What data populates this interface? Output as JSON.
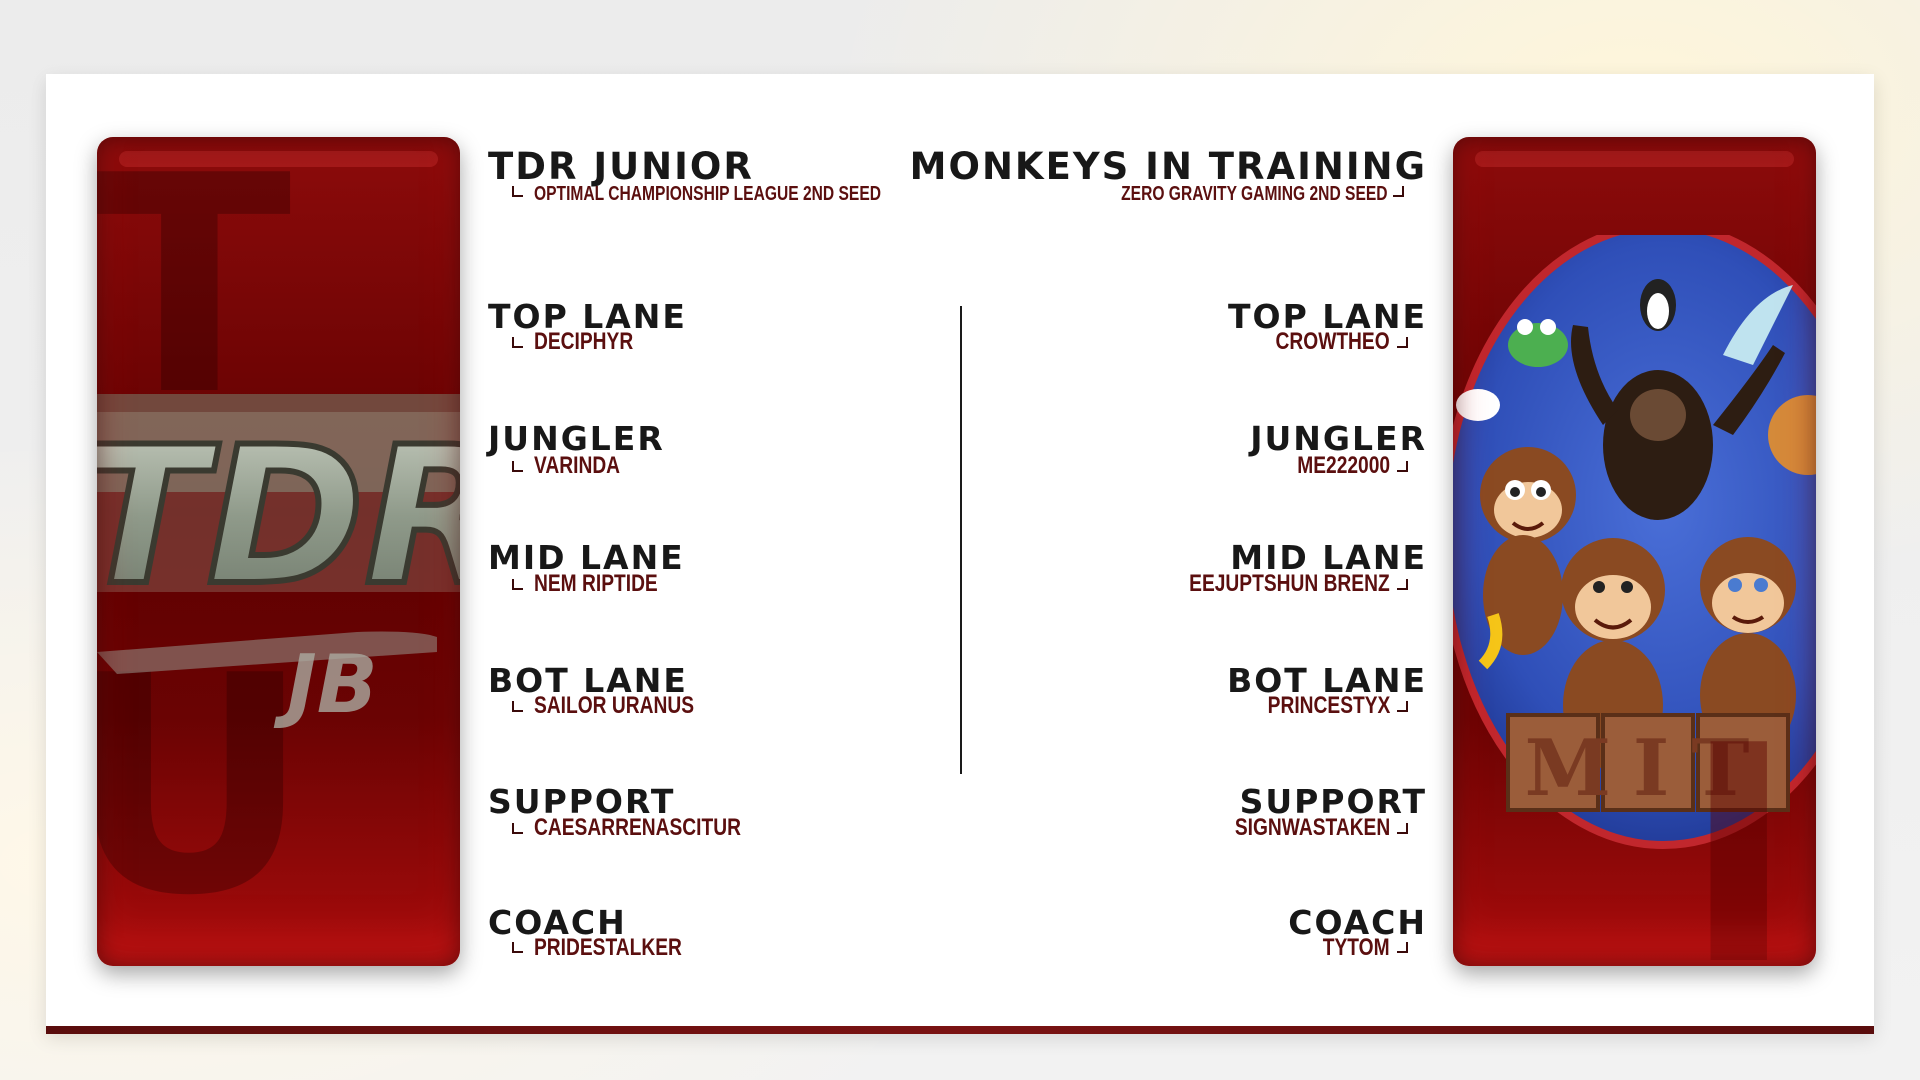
{
  "home": {
    "team_name": "TDR JUNIOR",
    "seed": "OPTIMAL CHAMPIONSHIP LEAGUE 2ND SEED",
    "logo_text": "TDR",
    "roster": [
      {
        "role": "TOP LANE",
        "player": "DECIPHYR"
      },
      {
        "role": "JUNGLER",
        "player": "VARINDA"
      },
      {
        "role": "MID LANE",
        "player": "NEM RIPTIDE"
      },
      {
        "role": "BOT LANE",
        "player": "SAILOR URANUS"
      },
      {
        "role": "SUPPORT",
        "player": "CAESARRENASCITUR"
      },
      {
        "role": "COACH",
        "player": "PRIDESTALKER"
      }
    ]
  },
  "away": {
    "team_name": "MONKEYS IN TRAINING",
    "seed": "ZERO GRAVITY GAMING 2ND SEED",
    "logo_text": "MIT",
    "roster": [
      {
        "role": "TOP LANE",
        "player": "CROWTHEO"
      },
      {
        "role": "JUNGLER",
        "player": "ME222000"
      },
      {
        "role": "MID LANE",
        "player": "EEJUPTSHUN BRENZ"
      },
      {
        "role": "BOT LANE",
        "player": "PRINCESTYX"
      },
      {
        "role": "SUPPORT",
        "player": "SIGNWASTAKEN"
      },
      {
        "role": "COACH",
        "player": "TYTOM"
      }
    ]
  },
  "colors": {
    "accent_dark_red": "#5b0f0f",
    "panel_red": "#8d0b0b",
    "title_text": "#181818"
  }
}
